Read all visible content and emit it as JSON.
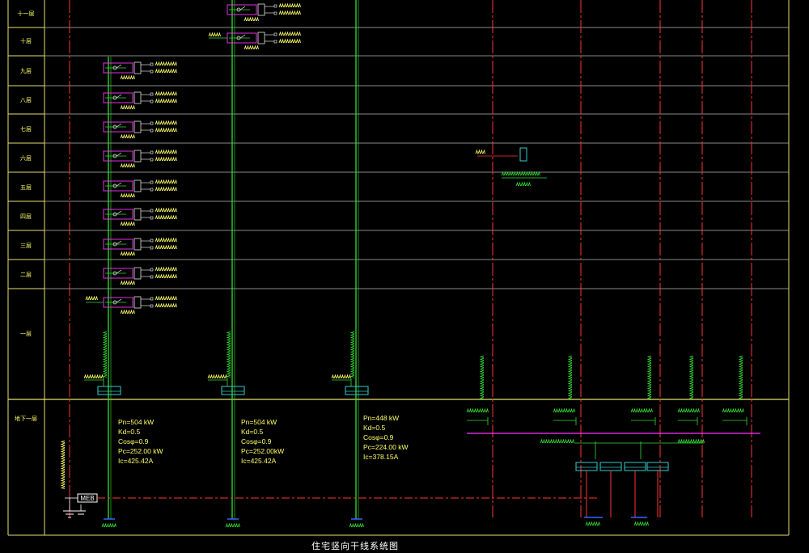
{
  "drawing": {
    "title": "住宅竖向干线系统图",
    "colors": {
      "background": "#000000",
      "frame": "#e8e070",
      "grid": "#b8b8b8",
      "riser_green": "#33dd33",
      "riser_red": "#ff3333",
      "bus_magenta": "#ff33ff",
      "label_yellow": "#ffff66",
      "box_cyan": "#33cccc",
      "base_blue": "#3366ff"
    },
    "floors": [
      {
        "label": "十一层"
      },
      {
        "label": "十层"
      },
      {
        "label": "九层"
      },
      {
        "label": "八层"
      },
      {
        "label": "七层"
      },
      {
        "label": "六层"
      },
      {
        "label": "五层"
      },
      {
        "label": "四层"
      },
      {
        "label": "三层"
      },
      {
        "label": "二层"
      },
      {
        "label": "一层"
      },
      {
        "label": "地下一层"
      }
    ],
    "load_calcs": [
      {
        "pn": "Pn=504 kW",
        "kd": "Kd=0.5",
        "cos": "Cosφ=0.9",
        "pc": "Pc=252.00 kW",
        "ic": "Ic=425.42A"
      },
      {
        "pn": "Pn=504 kW",
        "kd": "Kd=0.5",
        "cos": "Cosφ=0.9",
        "pc": "Pc=252.00kW",
        "ic": "Ic=425.42A"
      },
      {
        "pn": "Pn=448 kW",
        "kd": "Kd=0.5",
        "cos": "Cosφ=0.9",
        "pc": "Pc=224.00 kW",
        "ic": "Ic=378.15A"
      }
    ],
    "equipment": {
      "meb_label": "MEB"
    }
  }
}
